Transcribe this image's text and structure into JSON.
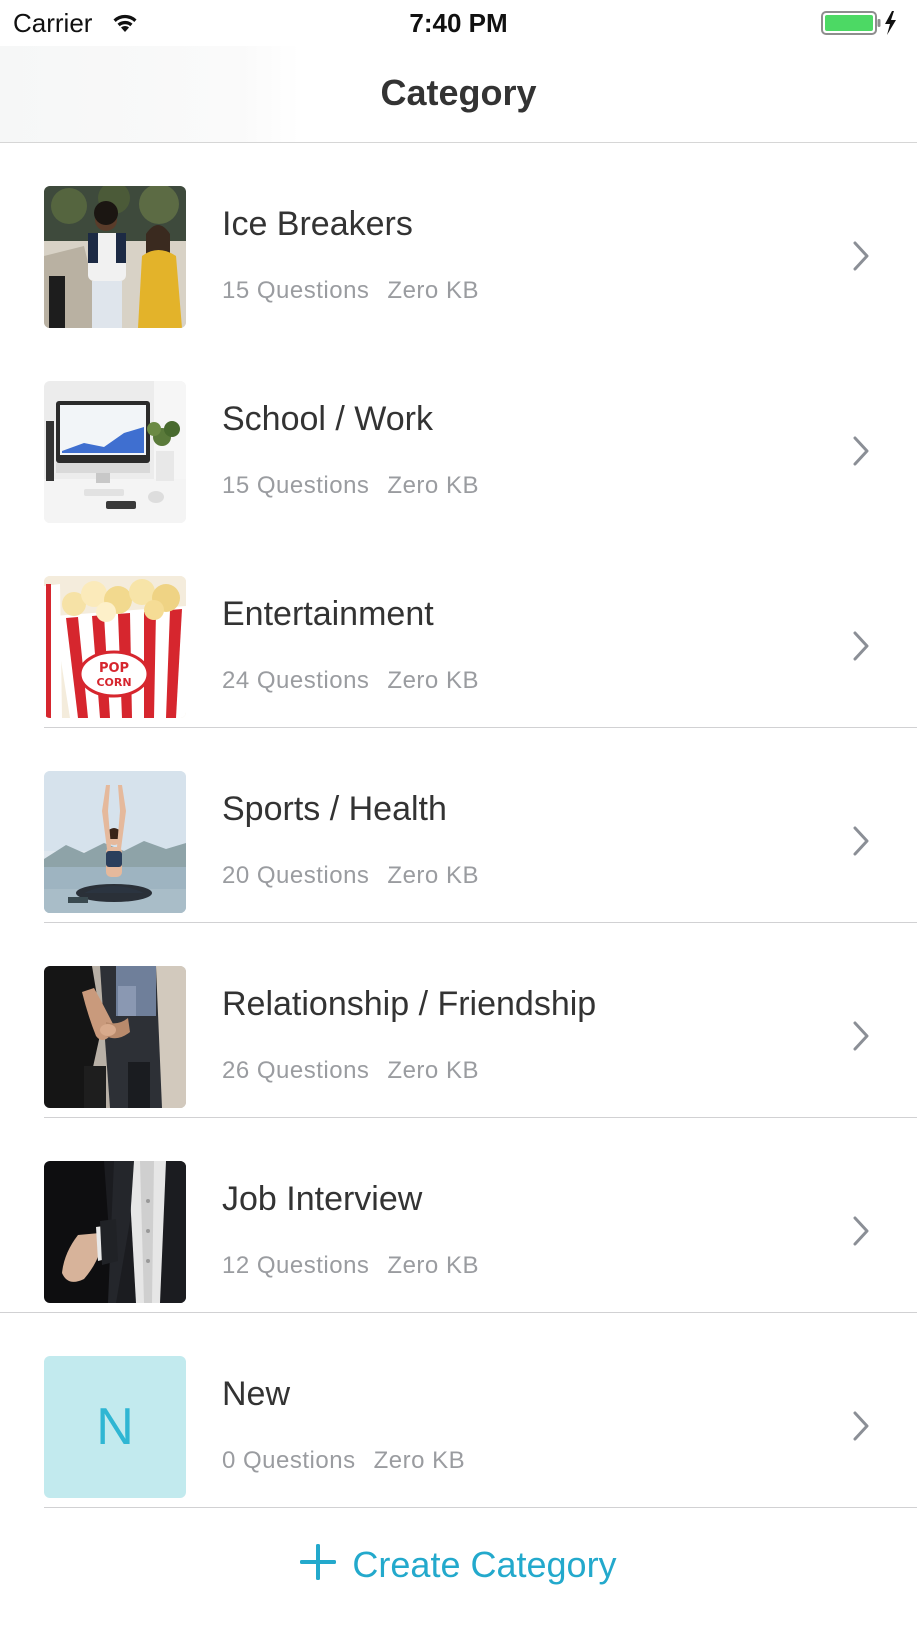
{
  "status_bar": {
    "carrier": "Carrier",
    "time": "7:40 PM",
    "wifi_icon": "wifi-icon",
    "battery_icon": "battery-charging-icon",
    "battery_color": "#4cd964"
  },
  "nav": {
    "title": "Category"
  },
  "categories": [
    {
      "title": "Ice Breakers",
      "questions": "15 Questions",
      "size": "Zero KB",
      "thumbnail": "photo"
    },
    {
      "title": "School / Work",
      "questions": "15 Questions",
      "size": "Zero KB",
      "thumbnail": "photo"
    },
    {
      "title": "Entertainment",
      "questions": "24 Questions",
      "size": "Zero KB",
      "thumbnail": "photo"
    },
    {
      "title": "Sports / Health",
      "questions": "20 Questions",
      "size": "Zero KB",
      "thumbnail": "photo"
    },
    {
      "title": "Relationship / Friendship",
      "questions": "26 Questions",
      "size": "Zero KB",
      "thumbnail": "photo"
    },
    {
      "title": "Job Interview",
      "questions": "12 Questions",
      "size": "Zero KB",
      "thumbnail": "photo"
    },
    {
      "title": "New",
      "questions": "0 Questions",
      "size": "Zero KB",
      "thumbnail": "letter",
      "letter": "N"
    }
  ],
  "create_button": {
    "label": "Create Category",
    "icon": "plus-icon"
  },
  "colors": {
    "accent": "#23a9cc",
    "letter_tile_bg": "#c2eaee",
    "secondary_text": "#9a9ca0",
    "separator": "#d1d1d3"
  }
}
